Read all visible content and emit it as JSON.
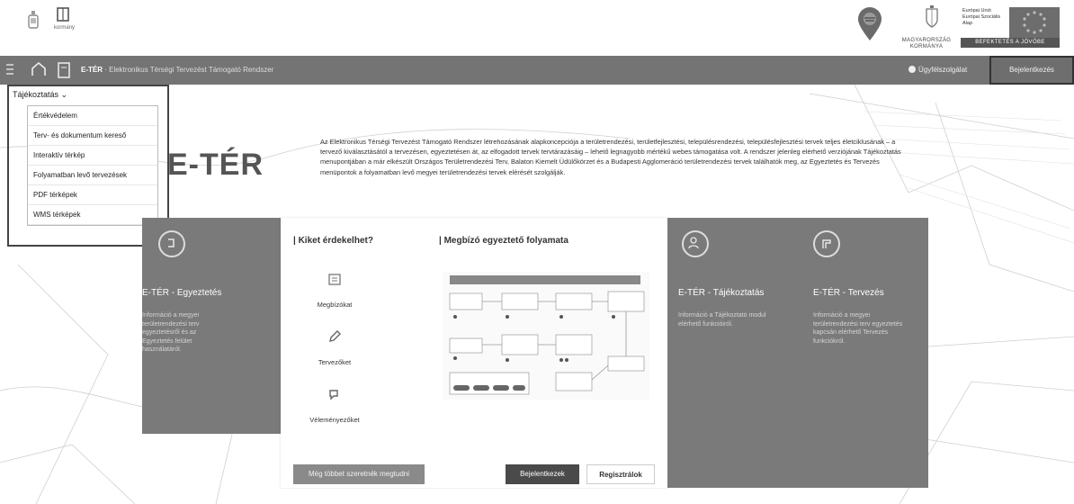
{
  "topbar": {
    "small_label": "kormány",
    "gov_text": "MAGYARORSZÁG KORMÁNYA",
    "eu_text_1": "Európai Unió",
    "eu_text_2": "Európai Szociális",
    "eu_text_3": "Alap",
    "eu_bar": "BEFEKTETÉS A JÖVŐBE"
  },
  "nav": {
    "brand": "E-TÉR",
    "subtitle": "· Elektronikus Térségi Tervezést Támogató Rendszer",
    "help": "Ügyfélszolgálat",
    "login": "Bejelentkezés"
  },
  "menu": {
    "toggle": "Tájékoztatás ⌄",
    "items": [
      "Értékvédelem",
      "Terv- és dokumentum kereső",
      "Interaktív térkép",
      "Folyamatban levő tervezések",
      "PDF térképek",
      "WMS térképek"
    ]
  },
  "hero": {
    "title": "E-TÉR",
    "intro": "Az Elektronikus Térségi Tervezést Támogató Rendszer létrehozásának alapkoncepciója a területrendezési, területfejlesztési, településrendezési, településfejlesztési tervek teljes életciklusának – a tervező kiválasztásától a tervezésen, egyeztetésen át, az elfogadott tervek tervtárazásáig – lehető legnagyobb mértékű webes támogatása volt. A rendszer jelenleg elérhető verziójának Tájékoztatás menupontjában a már elkészült Országos Területrendezési Terv, Balaton Kiemelt Üdülőkörzet és a Budapesti Agglomeráció területrendezési tervek találhatók meg, az Egyeztetés és Tervezés menüpontok a folyamatban levő megyei területrendezési tervek elérését szolgálják."
  },
  "card_egyeztetes": {
    "title": "E-TÉR - Egyeztetés",
    "desc": "Információ a megyei területrendezési terv egyeztetésről és az Egyeztetés felület használatáról."
  },
  "middle": {
    "who_title": "| Kiket érdekelhet?",
    "who": [
      "Megbízókat",
      "Tervezőket",
      "Véleményezőket"
    ],
    "flow_title": "| Megbízó egyeztető folyamata",
    "btn_more": "Még többet szeretnék megtudni",
    "btn_login": "Bejelentkezek",
    "btn_register": "Regisztrálok"
  },
  "card_tajekoztatas": {
    "title": "E-TÉR - Tájékoztatás",
    "desc": "Információ a Tájékoztató modul elérhető funkcióiról."
  },
  "card_tervezes": {
    "title": "E-TÉR - Tervezés",
    "desc": "Információ a megyei területrendezési terv egyeztetés kapcsán elérhető Tervezés funkciókról."
  }
}
